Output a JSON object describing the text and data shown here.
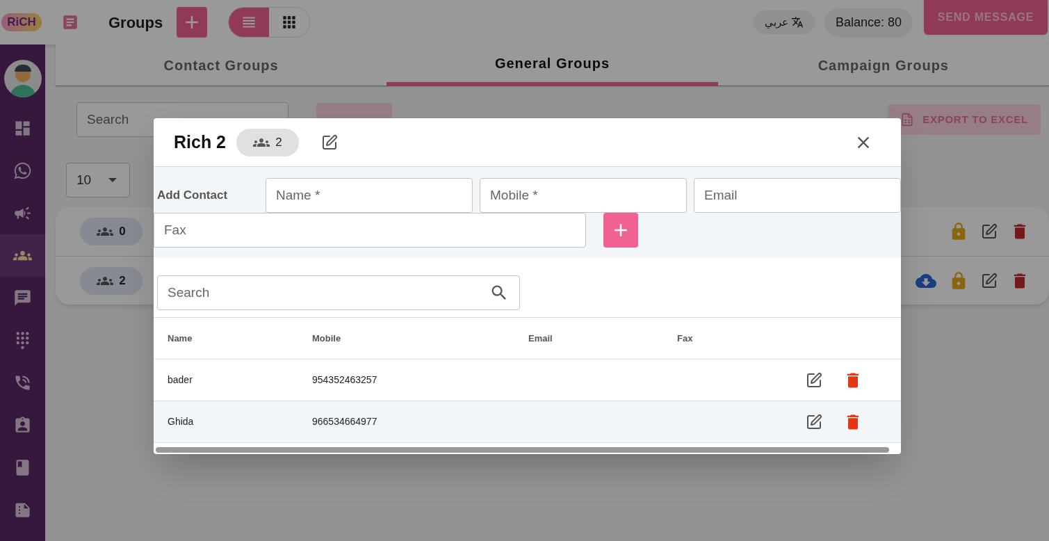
{
  "header": {
    "logo": "RiCH",
    "title": "Groups",
    "views": [
      {
        "kind": "list",
        "selected": true
      },
      {
        "kind": "grid",
        "selected": false
      }
    ],
    "language": "عربي",
    "balance": "Balance: 80",
    "send_button": "SEND MESSAGE"
  },
  "sidebar": {
    "items": [
      {
        "kind": "dashboard",
        "selected": false
      },
      {
        "kind": "whatsapp",
        "selected": false
      },
      {
        "kind": "campaign",
        "selected": false
      },
      {
        "kind": "groups",
        "selected": true
      },
      {
        "kind": "chat",
        "selected": false
      },
      {
        "kind": "dialpad",
        "selected": false
      },
      {
        "kind": "calls",
        "selected": false
      },
      {
        "kind": "contacts",
        "selected": false
      },
      {
        "kind": "book",
        "selected": false
      },
      {
        "kind": "report",
        "selected": false
      }
    ]
  },
  "tabs": [
    {
      "label": "Contact Groups",
      "selected": false
    },
    {
      "label": "General Groups",
      "selected": true
    },
    {
      "label": "Campaign Groups",
      "selected": false
    }
  ],
  "toolbar": {
    "search_placeholder": "Search",
    "export_button": "EXPORT TO EXCEL",
    "page_size": "10"
  },
  "groups": [
    {
      "count": "0",
      "downloadable": false
    },
    {
      "count": "2",
      "downloadable": true
    }
  ],
  "dialog": {
    "title": "Rich 2",
    "member_count": "2",
    "add_contact_label": "Add Contact",
    "fields": [
      {
        "placeholder": "Name *"
      },
      {
        "placeholder": "Mobile *"
      },
      {
        "placeholder": "Email"
      },
      {
        "placeholder": "Fax"
      }
    ],
    "search_placeholder": "Search",
    "columns": [
      "Name",
      "Mobile",
      "Email",
      "Fax"
    ],
    "rows": [
      {
        "name": "bader",
        "mobile": "954352463257",
        "email": "",
        "fax": ""
      },
      {
        "name": "Ghida",
        "mobile": "966534664977",
        "email": "",
        "fax": ""
      }
    ]
  }
}
